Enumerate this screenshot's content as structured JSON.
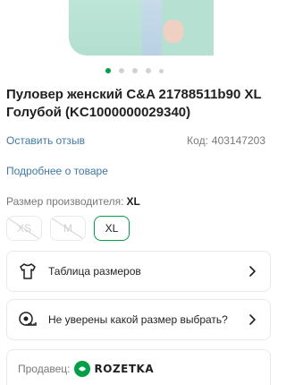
{
  "product": {
    "title": "Пуловер женский C&A 21788511b90 XL Голубой (KC1000000029340)",
    "code_label": "Код:",
    "code_value": "403147203"
  },
  "gallery": {
    "total_dots": 5,
    "active_dot": 1
  },
  "links": {
    "review": "Оставить отзыв",
    "details": "Подробнее о товаре"
  },
  "sizes": {
    "label": "Размер производителя:",
    "selected": "XL",
    "options": [
      "XS",
      "M",
      "XL"
    ]
  },
  "cards": {
    "size_table": "Таблица размеров",
    "size_help": "Не уверены какой размер выбрать?"
  },
  "seller": {
    "label": "Продавец:",
    "name": "ROZETKA"
  },
  "colors": {
    "accent": "#00a046",
    "link": "#3e77aa",
    "muted": "#797878"
  }
}
